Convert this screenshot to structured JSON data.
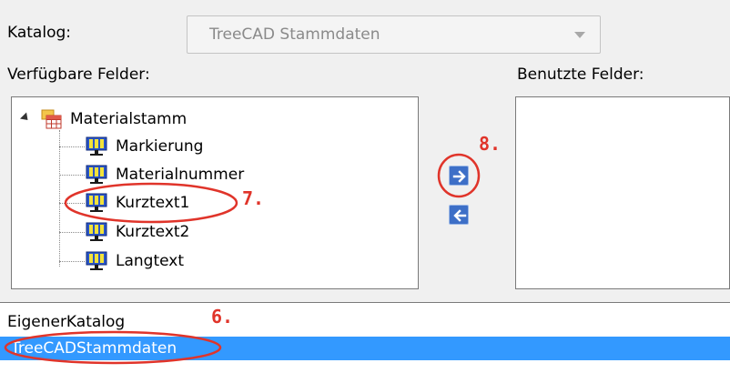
{
  "catalog": {
    "label": "Katalog:",
    "value": "TreeCAD Stammdaten"
  },
  "available": {
    "label": "Verfügbare Felder:",
    "root": "Materialstamm",
    "fields": [
      "Markierung",
      "Materialnummer",
      "Kurztext1",
      "Kurztext2",
      "Langtext"
    ]
  },
  "used": {
    "label": "Benutzte Felder:"
  },
  "buttons": {
    "add_icon": "arrow-right-icon",
    "remove_icon": "arrow-left-icon"
  },
  "catalog_list": {
    "items": [
      "EigenerKatalog",
      "TreeCADStammdaten"
    ],
    "selected_index": 1
  },
  "annotations": {
    "step6": "6.",
    "step7": "7.",
    "step8": "8."
  },
  "colors": {
    "selection": "#3399ff",
    "annotation": "#e0342a",
    "arrow_button": "#3d6fc7"
  }
}
